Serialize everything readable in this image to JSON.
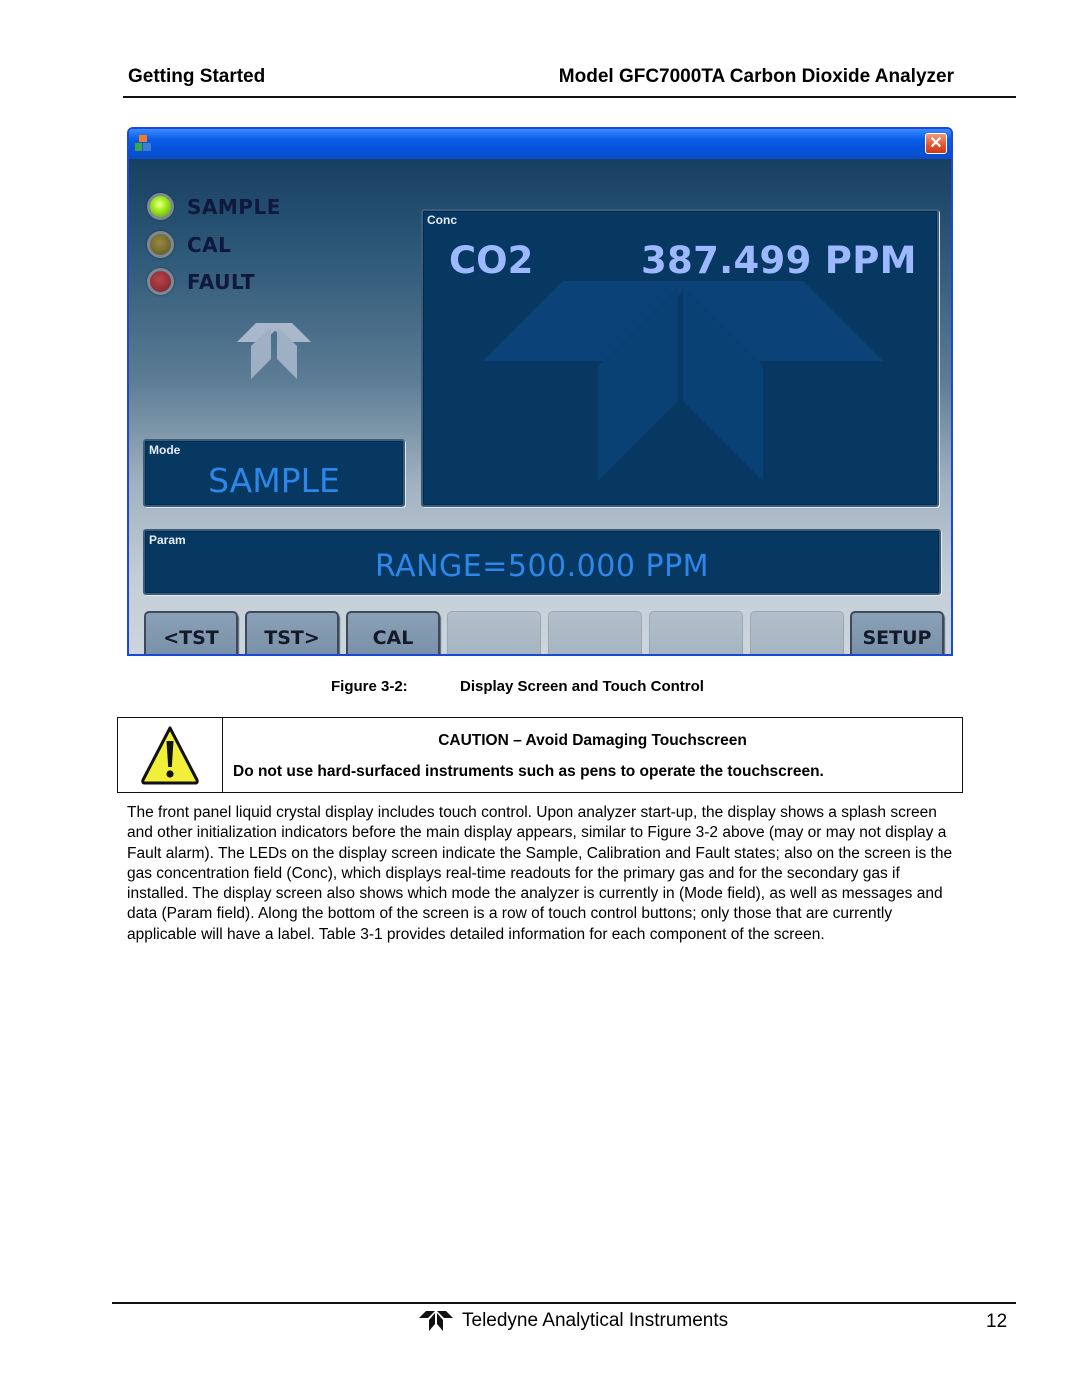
{
  "header": {
    "section": "Getting Started",
    "product": "Model GFC7000TA Carbon Dioxide Analyzer"
  },
  "figure": {
    "window": {
      "icon": "app-icon",
      "close_icon": "close-icon",
      "close_glyph": "✕"
    },
    "leds": [
      {
        "label": "SAMPLE",
        "state": "on",
        "color": "#a6f020"
      },
      {
        "label": "CAL",
        "state": "off",
        "color": "#6d6229"
      },
      {
        "label": "FAULT",
        "state": "off",
        "color": "#8e2a33"
      }
    ],
    "conc": {
      "caption": "Conc",
      "gas": "CO2",
      "value": "387.499 PPM"
    },
    "mode": {
      "caption": "Mode",
      "value": "SAMPLE"
    },
    "param": {
      "caption": "Param",
      "value": "RANGE=500.000 PPM"
    },
    "buttons": [
      {
        "label": "<TST",
        "active": true
      },
      {
        "label": "TST>",
        "active": true
      },
      {
        "label": "CAL",
        "active": true
      },
      {
        "label": "",
        "active": false
      },
      {
        "label": "",
        "active": false
      },
      {
        "label": "",
        "active": false
      },
      {
        "label": "",
        "active": false
      },
      {
        "label": "SETUP",
        "active": true
      }
    ],
    "caption_number": "Figure 3-2:",
    "caption_text": "Display Screen and Touch Control"
  },
  "caution": {
    "icon": "warning-icon",
    "title": "CAUTION – Avoid Damaging Touchscreen",
    "body": "Do not use hard-surfaced instruments such as pens to operate the touchscreen."
  },
  "paragraph": "The front panel liquid crystal display includes touch control. Upon analyzer start-up, the display shows a splash screen and other initialization indicators before the main display appears, similar to Figure 3-2 above (may or may not display a Fault alarm). The LEDs on the display screen indicate the Sample, Calibration and Fault states; also on the screen is the gas concentration field (Conc), which displays real-time readouts for the primary gas and for the secondary gas if installed. The display screen also shows which mode the analyzer is currently in (Mode field), as well as messages and data (Param field). Along the bottom of the screen is a row of touch control buttons; only those that are currently applicable will have a label. Table 3-1 provides detailed information for each component of the screen.",
  "footer": {
    "brand": "Teledyne Analytical Instruments",
    "page": "12"
  }
}
